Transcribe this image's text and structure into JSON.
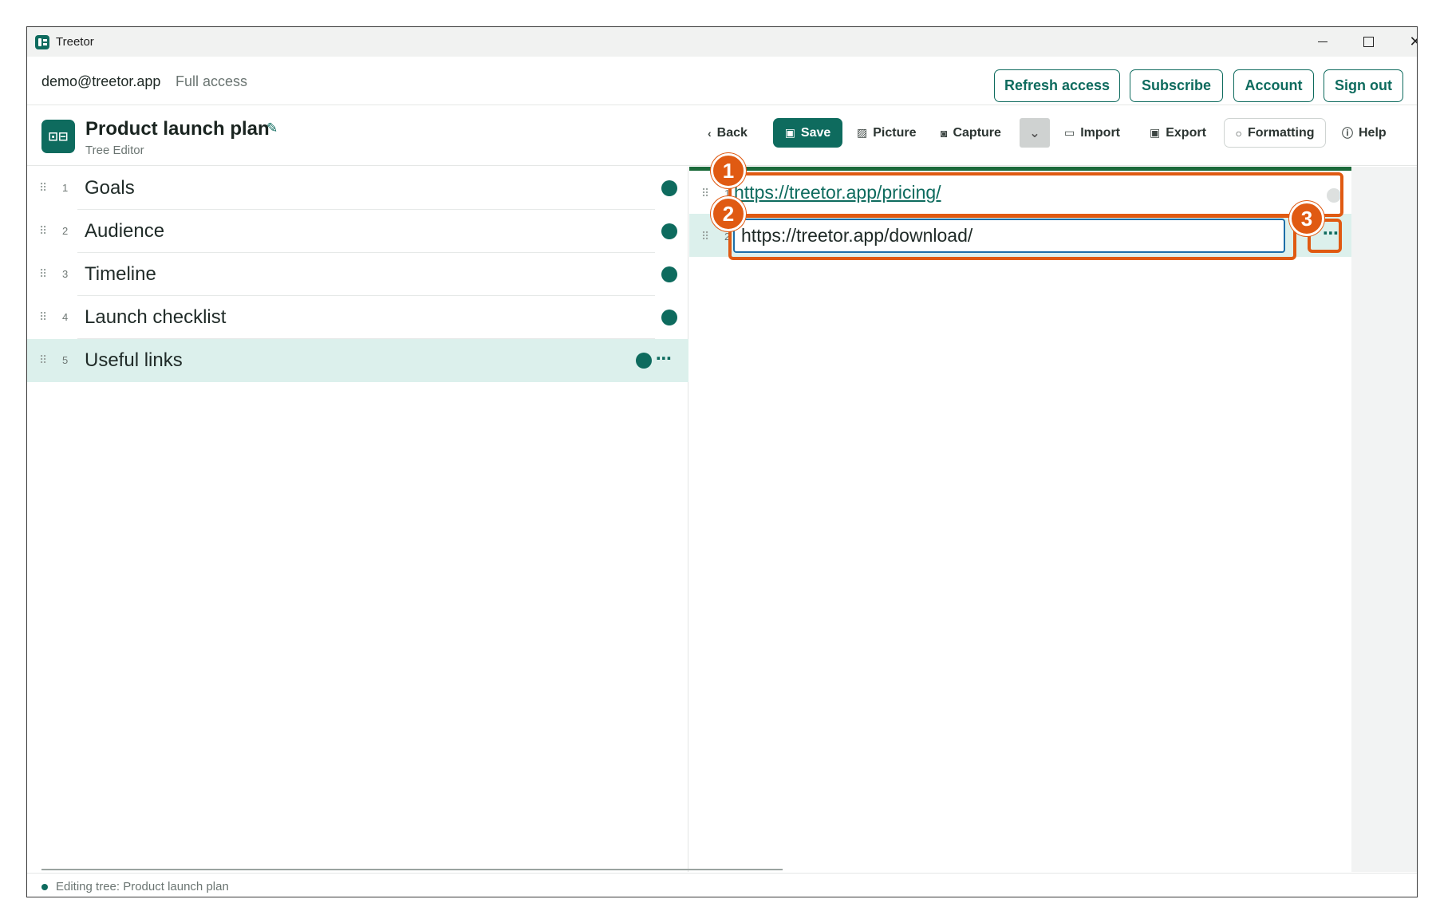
{
  "window": {
    "title": "Treetor"
  },
  "account": {
    "email": "demo@treetor.app",
    "access": "Full access",
    "buttons": {
      "refresh": "Refresh access",
      "subscribe": "Subscribe",
      "account": "Account",
      "signout": "Sign out"
    }
  },
  "doc": {
    "title": "Product launch plan",
    "subtitle": "Tree Editor",
    "logo": "῕⫫"
  },
  "toolbar": {
    "back": "Back",
    "save": "Save",
    "picture": "Picture",
    "capture": "Capture",
    "import": "Import",
    "export": "Export",
    "formatting": "Formatting",
    "help": "Help"
  },
  "tree": {
    "items": [
      {
        "num": "1",
        "label": "Goals"
      },
      {
        "num": "2",
        "label": "Audience"
      },
      {
        "num": "3",
        "label": "Timeline"
      },
      {
        "num": "4",
        "label": "Launch checklist"
      },
      {
        "num": "5",
        "label": "Useful links"
      }
    ]
  },
  "links": {
    "rows": [
      {
        "num": "1",
        "value": "https://treetor.app/pricing/"
      },
      {
        "num": "2",
        "value": "https://treetor.app/download/"
      }
    ]
  },
  "callouts": [
    "1",
    "2",
    "3"
  ],
  "status": {
    "text": "Editing tree: Product launch plan"
  },
  "colors": {
    "accent": "#0e6b5e",
    "callout": "#e05a12",
    "selected_row": "#dcf0ec"
  }
}
